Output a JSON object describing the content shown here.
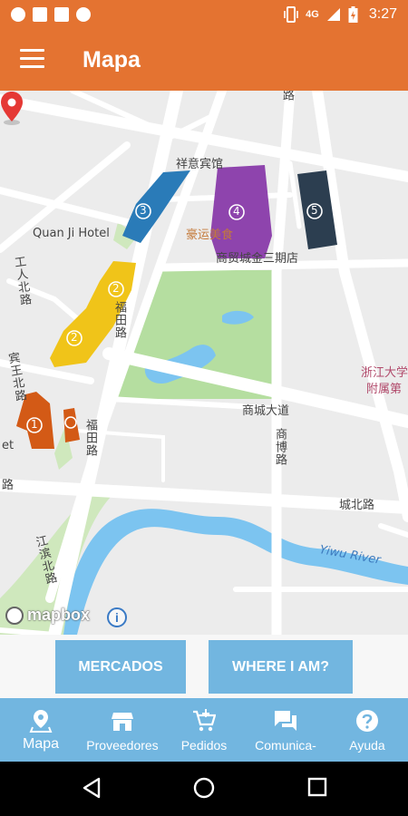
{
  "status_bar": {
    "time": "3:27",
    "network": "4G",
    "left_icons": [
      "b-circle-icon",
      "mail-icon",
      "image-icon",
      "circle-icon"
    ],
    "right_icons": [
      "vibrate-icon",
      "signal-icon",
      "battery-icon"
    ]
  },
  "app_bar": {
    "title": "Mapa",
    "menu_icon": "hamburger-icon"
  },
  "colors": {
    "primary": "#e47331",
    "accent": "#72b6e0",
    "market_1": "#d35a16",
    "market_2": "#f0c419",
    "market_3": "#2a7bb8",
    "market_4": "#8e44ad",
    "market_5": "#2c3e50",
    "park": "#b5dea0",
    "water": "#7cc4f0"
  },
  "map": {
    "labels": {
      "quan_ji_hotel": "Quan Ji Hotel",
      "road_top": "路",
      "xiangyi": "祥意宾馆",
      "haoyun": "豪运美食",
      "nanrou": "商贸城金三期店",
      "gongren_north": "工人北路",
      "futian": "福田路",
      "binwang": "宾王北路",
      "futian_2": "福田路",
      "shangcheng_ave": "商城大道",
      "shangbo": "商博路",
      "chengbei": "城北路",
      "road_left": "路",
      "jiangbin": "江滨北路",
      "river": "Yiwu River",
      "zhejiang_uni": "浙江大学",
      "fushu": "附属第",
      "et": "et"
    },
    "markets": [
      "1",
      "2",
      "3",
      "4",
      "5"
    ],
    "attribution": "mapbox",
    "info_label": "i"
  },
  "actions": {
    "markets_label": "MERCADOS",
    "where_label": "WHERE I AM?"
  },
  "bottom_nav": {
    "items": [
      {
        "label": "Mapa",
        "icon": "map-pin-icon"
      },
      {
        "label": "Proveedores",
        "icon": "store-icon"
      },
      {
        "label": "Pedidos",
        "icon": "cart-icon"
      },
      {
        "label": "Comunica-",
        "icon": "chat-icon"
      },
      {
        "label": "Ayuda",
        "icon": "help-icon"
      }
    ]
  }
}
